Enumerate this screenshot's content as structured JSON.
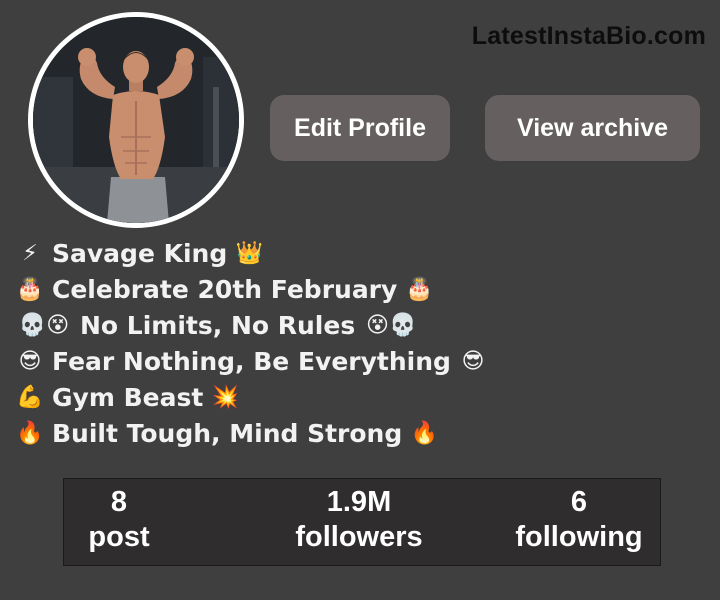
{
  "watermark": "LatestInstaBio.com",
  "profile": {
    "avatar_icon": "profile-photo-bodybuilder"
  },
  "buttons": {
    "edit_profile": "Edit Profile",
    "view_archive": "View archive"
  },
  "bio": [
    {
      "lead": "⚡",
      "text": "Savage King",
      "trail": "👑"
    },
    {
      "lead": "🎂",
      "text": "Celebrate 20th February",
      "trail": "🎂"
    },
    {
      "lead": "💀😵",
      "text": "No Limits, No Rules",
      "trail": "😵💀"
    },
    {
      "lead": "😎",
      "text": "Fear Nothing, Be Everything",
      "trail": "😎"
    },
    {
      "lead": "💪",
      "text": "Gym Beast",
      "trail": "💥"
    },
    {
      "lead": "🔥",
      "text": "Built Tough, Mind Strong",
      "trail": "🔥"
    }
  ],
  "stats": {
    "post": {
      "value": "8",
      "label": "post"
    },
    "followers": {
      "value": "1.9M",
      "label": "followers"
    },
    "following": {
      "value": "6",
      "label": "following"
    }
  },
  "colors": {
    "background": "#3f3f3f",
    "button": "#655f5f",
    "stats_box": "#2f2d2d"
  }
}
